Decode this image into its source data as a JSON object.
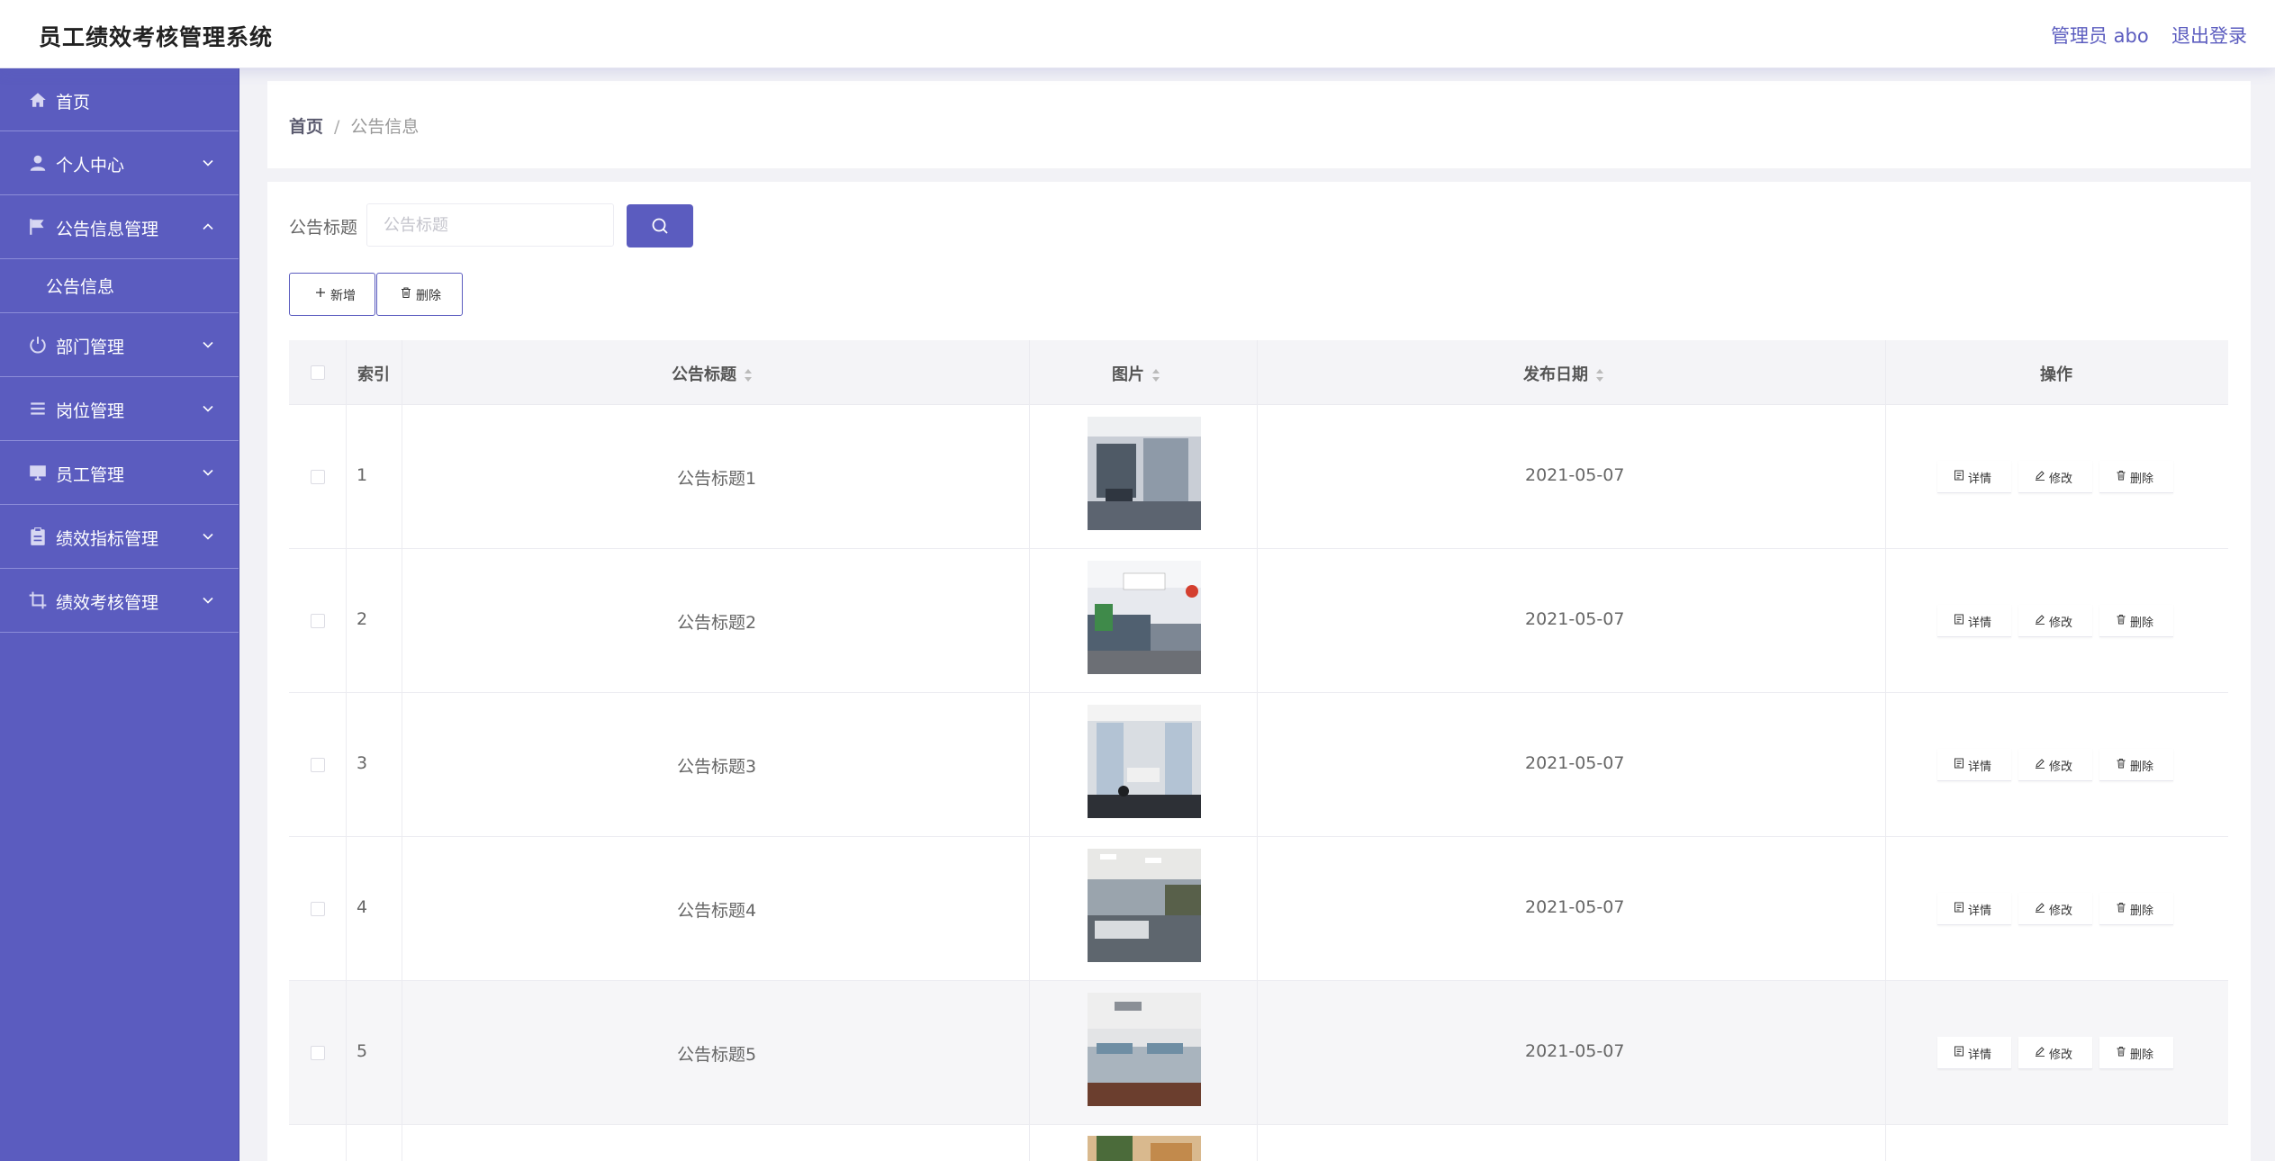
{
  "header": {
    "title": "员工绩效考核管理系统",
    "user": "管理员 abo",
    "logout": "退出登录"
  },
  "sidebar": {
    "items": [
      {
        "label": "首页",
        "icon": "home-icon"
      },
      {
        "label": "个人中心",
        "icon": "user-icon",
        "expandable": true
      },
      {
        "label": "公告信息管理",
        "icon": "flag-icon",
        "expandable": true,
        "expanded": true
      },
      {
        "label": "部门管理",
        "icon": "power-icon",
        "expandable": true
      },
      {
        "label": "岗位管理",
        "icon": "list-icon",
        "expandable": true
      },
      {
        "label": "员工管理",
        "icon": "monitor-icon",
        "expandable": true
      },
      {
        "label": "绩效指标管理",
        "icon": "clipboard-icon",
        "expandable": true
      },
      {
        "label": "绩效考核管理",
        "icon": "crop-icon",
        "expandable": true
      }
    ],
    "subitem": "公告信息"
  },
  "breadcrumb": {
    "home": "首页",
    "separator": "/",
    "current": "公告信息"
  },
  "search": {
    "label": "公告标题",
    "placeholder": "公告标题",
    "value": ""
  },
  "actions": {
    "add": "新增",
    "delete": "删除"
  },
  "table": {
    "columns": {
      "index": "索引",
      "title": "公告标题",
      "image": "图片",
      "date": "发布日期",
      "ops": "操作"
    },
    "rows": [
      {
        "index": "1",
        "title": "公告标题1",
        "date": "2021-05-07"
      },
      {
        "index": "2",
        "title": "公告标题2",
        "date": "2021-05-07"
      },
      {
        "index": "3",
        "title": "公告标题3",
        "date": "2021-05-07"
      },
      {
        "index": "4",
        "title": "公告标题4",
        "date": "2021-05-07"
      },
      {
        "index": "5",
        "title": "公告标题5",
        "date": "2021-05-07"
      }
    ],
    "row_actions": {
      "detail": "详情",
      "edit": "修改",
      "delete": "删除"
    }
  },
  "colors": {
    "primary": "#5b5cbf",
    "sidebar": "#5b5cbf",
    "border": "#8c8dd8"
  }
}
